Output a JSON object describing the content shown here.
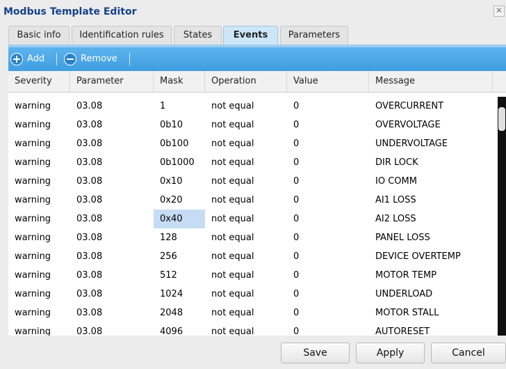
{
  "window": {
    "title": "Modbus Template Editor",
    "close_glyph": "✕"
  },
  "tabs": [
    {
      "label": "Basic info",
      "active": false
    },
    {
      "label": "Identification rules",
      "active": false
    },
    {
      "label": "States",
      "active": false
    },
    {
      "label": "Events",
      "active": true
    },
    {
      "label": "Parameters",
      "active": false
    }
  ],
  "toolbar": {
    "add_label": "Add",
    "add_icon": "plus-circle-icon",
    "remove_label": "Remove",
    "remove_icon": "minus-circle-icon",
    "background_color": "#3f9ee0"
  },
  "grid": {
    "columns": [
      "Severity",
      "Parameter",
      "Mask",
      "Operation",
      "Value",
      "Message"
    ],
    "rows": [
      [
        "warning",
        "03.08",
        "1",
        "not equal",
        "0",
        "OVERCURRENT"
      ],
      [
        "warning",
        "03.08",
        "0b10",
        "not equal",
        "0",
        "OVERVOLTAGE"
      ],
      [
        "warning",
        "03.08",
        "0b100",
        "not equal",
        "0",
        "UNDERVOLTAGE"
      ],
      [
        "warning",
        "03.08",
        "0b1000",
        "not equal",
        "0",
        "DIR LOCK"
      ],
      [
        "warning",
        "03.08",
        "0x10",
        "not equal",
        "0",
        "IO COMM"
      ],
      [
        "warning",
        "03.08",
        "0x20",
        "not equal",
        "0",
        "AI1 LOSS"
      ],
      [
        "warning",
        "03.08",
        "0x40",
        "not equal",
        "0",
        "AI2 LOSS"
      ],
      [
        "warning",
        "03.08",
        "128",
        "not equal",
        "0",
        "PANEL LOSS"
      ],
      [
        "warning",
        "03.08",
        "256",
        "not equal",
        "0",
        "DEVICE OVERTEMP"
      ],
      [
        "warning",
        "03.08",
        "512",
        "not equal",
        "0",
        "MOTOR TEMP"
      ],
      [
        "warning",
        "03.08",
        "1024",
        "not equal",
        "0",
        "UNDERLOAD"
      ],
      [
        "warning",
        "03.08",
        "2048",
        "not equal",
        "0",
        "MOTOR STALL"
      ],
      [
        "warning",
        "03.08",
        "4096",
        "not equal",
        "0",
        "AUTORESET"
      ]
    ],
    "selected_cell": {
      "row": 6,
      "column": 2
    },
    "selected_color": "#c6dcf5"
  },
  "footer": {
    "save_label": "Save",
    "apply_label": "Apply",
    "cancel_label": "Cancel"
  }
}
